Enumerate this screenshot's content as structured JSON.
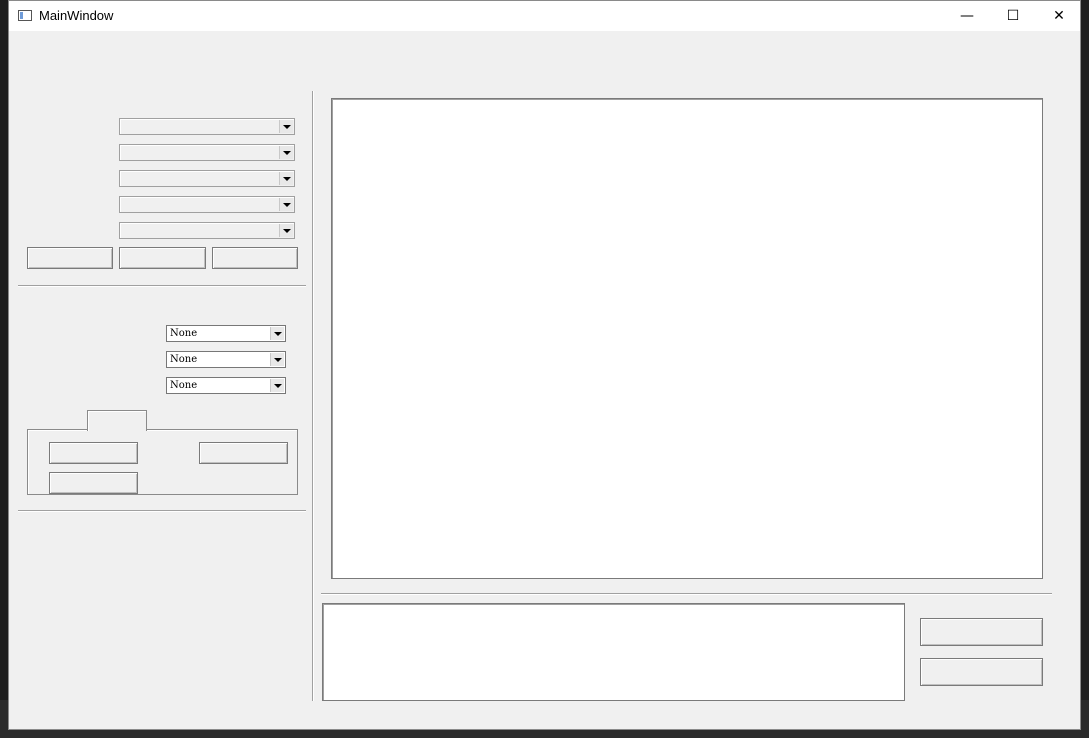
{
  "window": {
    "title": "MainWindow",
    "min_symbol": "—",
    "max_symbol": "☐",
    "close_symbol": "✕"
  },
  "serial_info": {
    "group_label": "",
    "port_label": "",
    "baud_label": "",
    "data_bits_label": "",
    "parity_label": "",
    "stop_bits_label": "",
    "open_button": "",
    "close_button": "",
    "refresh_button": ""
  },
  "wifi": {
    "mode_label": "",
    "mode_value": "None",
    "rate_label": "",
    "rate_value": "None",
    "channel_label": "",
    "channel_value": "None"
  },
  "tabs": {
    "rx_tab": "",
    "tx_tab": "",
    "btn_11b": "",
    "btn_11g": "",
    "btn_11n": ""
  },
  "burn": {
    "label": ""
  },
  "right": {
    "title": "",
    "send_button": "",
    "clear_button": ""
  }
}
